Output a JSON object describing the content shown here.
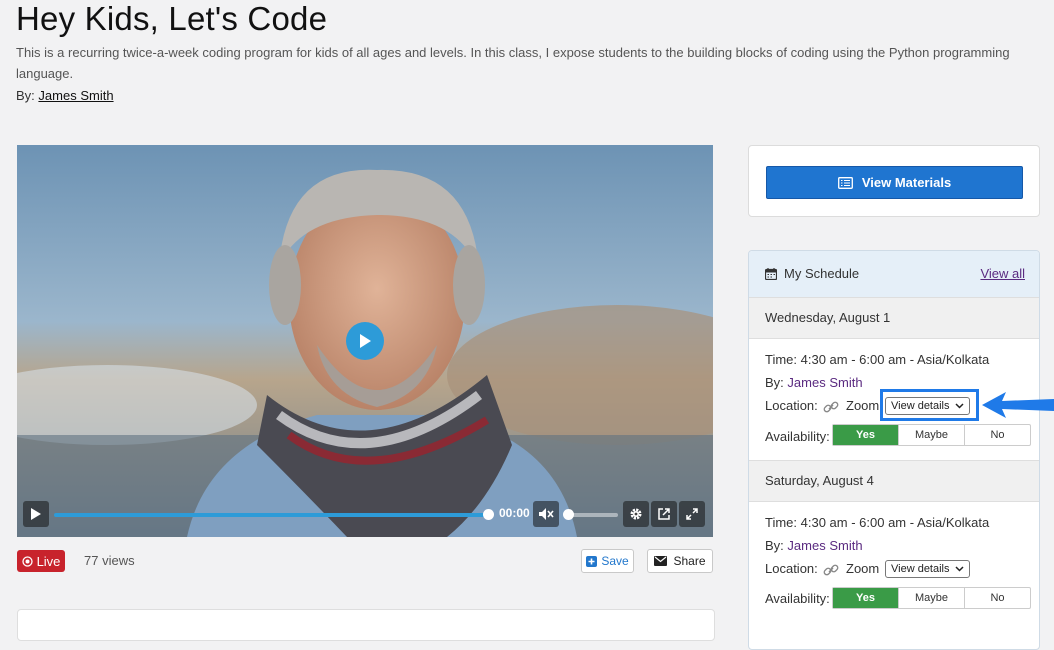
{
  "page": {
    "title": "Hey Kids, Let's Code",
    "description": "This is a recurring twice-a-week coding program for kids of all ages and levels. In this class, I expose students to the building blocks of coding using the Python programming language.",
    "by_prefix": "By:",
    "author": "James Smith"
  },
  "video": {
    "time": "00:00",
    "progress_fraction": 1.0,
    "volume_fraction": 0.0,
    "icons": [
      "play-icon",
      "mute-icon",
      "gear-icon",
      "popout-icon",
      "fullscreen-icon"
    ]
  },
  "meta": {
    "live_label": "Live",
    "views": "77 views",
    "save_label": "Save",
    "share_label": "Share"
  },
  "sidebar": {
    "materials_label": "View Materials",
    "schedule_title": "My Schedule",
    "view_all": "View all",
    "sessions": [
      {
        "day": "Wednesday, August 1",
        "time": "Time: 4:30 am - 6:00 am - Asia/Kolkata",
        "by_prefix": "By:",
        "by": "James Smith",
        "location_prefix": "Location:",
        "location": "Zoom",
        "details_label": "View details",
        "availability_label": "Availability:",
        "options": [
          "Yes",
          "Maybe",
          "No"
        ],
        "selected": "Yes"
      },
      {
        "day": "Saturday, August 4",
        "time": "Time: 4:30 am - 6:00 am - Asia/Kolkata",
        "by_prefix": "By:",
        "by": "James Smith",
        "location_prefix": "Location:",
        "location": "Zoom",
        "details_label": "View details",
        "availability_label": "Availability:",
        "options": [
          "Yes",
          "Maybe",
          "No"
        ],
        "selected": "Yes"
      }
    ]
  },
  "colors": {
    "accent": "#1f75d0",
    "live": "#c8232c",
    "yes": "#3a9b47",
    "link": "#5a2a80",
    "highlight": "#1f7ae8"
  }
}
